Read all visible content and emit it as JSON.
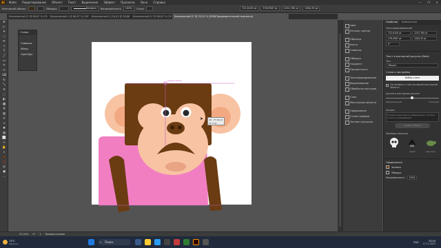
{
  "menubar": {
    "logo": "Ai",
    "items": [
      "Файл",
      "Редактирование",
      "Объект",
      "Текст",
      "Выделение",
      "Эффект",
      "Просмотр",
      "Окно",
      "Справка"
    ]
  },
  "window_controls": [
    "—",
    "❐",
    "✕"
  ],
  "control_bar": {
    "object_type": "Контурный объект",
    "fill_label": "",
    "stroke_label": "Обводка",
    "stroke_width": "",
    "brush_label": "Базовая",
    "opacity_label": "Непрозрачность",
    "opacity_value": "100%",
    "style_label": "Стиль",
    "x": "722,6109 pt",
    "y": "376,9387 pt",
    "w": "1232,765 pt",
    "h": "1284,35 pt"
  },
  "tabs": [
    {
      "label": "Безымянный-1* @ 66,67 % (CMYK/Предварительнаяпро...",
      "active": false
    },
    {
      "label": "Безымянный-1 @ 66,67 % (CMYK/Предварительн...",
      "active": false
    },
    {
      "label": "Безымянный-1 (16,41 @ 36,86 % (CMYK/Предварительн...",
      "active": false
    },
    {
      "label": "Безымянный-1* @ 66,67 % (CMYK/Предварительная...",
      "active": false
    },
    {
      "label": "Безымянный-5* @ 33,22 % (RGB/Предварительный просмотр)",
      "active": true
    }
  ],
  "toolbar_icons": [
    "selection-icon",
    "direct-selection-icon",
    "magic-wand-icon",
    "lasso-icon",
    "pen-icon",
    "curvature-icon",
    "type-icon",
    "line-icon",
    "rectangle-icon",
    "paintbrush-icon",
    "pencil-icon",
    "eraser-icon",
    "rotate-icon",
    "scale-icon",
    "width-icon",
    "free-transform-icon",
    "shape-builder-icon",
    "perspective-icon",
    "mesh-icon",
    "gradient-icon",
    "eyedropper-icon",
    "blend-icon",
    "symbol-sprayer-icon",
    "graph-icon",
    "artboard-icon",
    "slice-icon",
    "hand-icon",
    "zoom-icon",
    "fill-swatch-icon",
    "stroke-swatch-icon",
    "draw-mode-icon",
    "screen-mode-icon",
    "more-tools-icon"
  ],
  "toolbar_glyphs": [
    "➤",
    "▷",
    "✦",
    "◌",
    "✒",
    "∿",
    "T",
    "╱",
    "▭",
    "✎",
    "✏",
    "⌫",
    "↻",
    "⤡",
    "≋",
    "⬚",
    "◐",
    "▦",
    "#",
    "▤",
    "✐",
    "∞",
    "✺",
    "▥",
    "⬜",
    "✂",
    "✋",
    "⌕",
    "■",
    "□",
    "◎",
    "▣",
    "…"
  ],
  "flyout": {
    "header": "Глифы",
    "items": [
      "Символы",
      "Абзац",
      "OpenType"
    ]
  },
  "canvas": {
    "tooltip_line1": "dX: -77,02 pt",
    "tooltip_line2": "dY: 0 pt",
    "smart_guide": "пересечение"
  },
  "dock": {
    "groups": [
      [
        "Цвет",
        "Каталог цветов"
      ],
      [
        "Образцы",
        "Кисти",
        "Символы"
      ],
      [
        "Обводка",
        "Градиент",
        "Прозрачность"
      ],
      [
        "Трансформирование",
        "Выравнивание",
        "Обработка контуров"
      ],
      [
        "Слои",
        "Монтажные области"
      ]
    ],
    "extra": [
      "Оформление",
      "Стили графики",
      "Экспорт ресурсов"
    ]
  },
  "properties": {
    "tabs": [
      "Свойства",
      "Библиотеки"
    ],
    "section_transform": "Трансформирование",
    "x_value": "722,6109 pt",
    "y_value": "376,9387 pt",
    "w_value": "1232,765 pt",
    "h_value": "1284,35 pt",
    "angle_value": "0°",
    "trace_section": "Текст в векторный рисунок (Beta)",
    "type_label": "Тип",
    "type_value": "Объект",
    "style_settings": "Стили и настройки",
    "select_style": "Выбор стиля",
    "checkbox_label": "Согласовать стиль активной монтажной области",
    "detail_label": "Детали в векторном рисунке",
    "min_label": "Минимальный",
    "max_label": "Сложный",
    "prompt_label": "Запрос",
    "prompt_placeholder": "Опишите векторное изображение, которое хотите сгенерировать",
    "generate_button": "Создать (Beta)",
    "examples_label": "Примеры запросов",
    "example_captions": [
      "",
      "Череп",
      "Черепаха"
    ],
    "appearance_section": "Оформление",
    "fill_label": "Заливка",
    "stroke_label": "Обводка",
    "opacity_label": "Непрозрачность",
    "opacity_value": "100%"
  },
  "statusbar": {
    "zoom": "33,22%",
    "angle": "0°",
    "artboard": "1",
    "status": "Прямоугольник"
  },
  "taskbar": {
    "weather": "13°C",
    "weather_desc": "Облачно",
    "search": "Поиск",
    "time": "23:04",
    "date": "27.11.2023",
    "lang": "ENG"
  }
}
